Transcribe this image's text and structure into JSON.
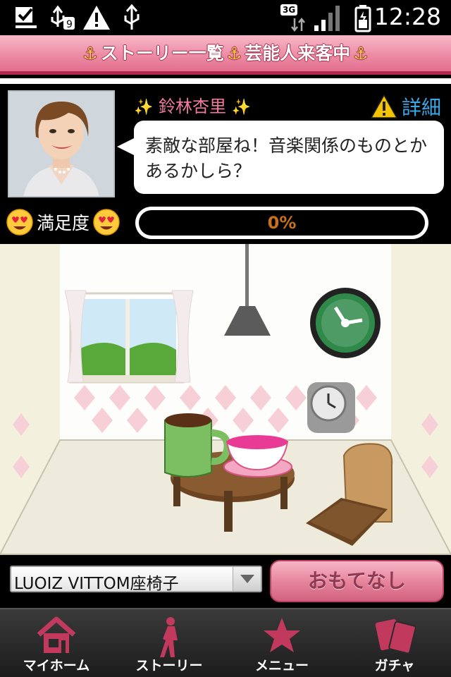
{
  "status_bar": {
    "time": "12:28",
    "network": "3G",
    "icons": [
      "download-complete-icon",
      "usb-debug-icon",
      "warning-icon",
      "usb-icon",
      "signal-icon",
      "battery-icon"
    ]
  },
  "header": {
    "title": "ストーリー一覧",
    "subtitle": "芸能人来客中"
  },
  "visitor": {
    "name": "鈴林杏里",
    "details_label": "詳細",
    "speech": "素敵な部屋ね！音楽関係のものとかあるかしら？"
  },
  "satisfaction": {
    "label": "満足度",
    "value_text": "0%",
    "value": 0
  },
  "controls": {
    "selected_item": "LUOIZ VITTOM座椅子",
    "action_label": "おもてなし"
  },
  "nav": {
    "items": [
      {
        "label": "マイホーム",
        "icon": "home-icon"
      },
      {
        "label": "ストーリー",
        "icon": "walking-person-icon"
      },
      {
        "label": "メニュー",
        "icon": "star-icon"
      },
      {
        "label": "ガチャ",
        "icon": "cards-icon"
      }
    ]
  },
  "colors": {
    "header_pink": "#ee8fa8",
    "accent_pink": "#b12a4e",
    "name_pink": "#f07aa0",
    "details_blue": "#3aa8e8",
    "nav_icon": "#c2395e"
  }
}
